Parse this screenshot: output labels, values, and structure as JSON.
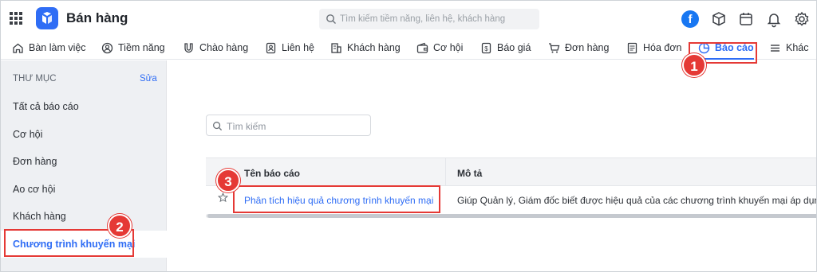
{
  "app": {
    "title": "Bán hàng"
  },
  "top_search": {
    "placeholder": "Tìm kiếm tiềm năng, liên hệ, khách hàng"
  },
  "top_icons": {
    "facebook_letter": "f"
  },
  "nav": {
    "items": [
      {
        "label": "Bàn làm việc",
        "icon": "home-icon"
      },
      {
        "label": "Tiềm năng",
        "icon": "user-circle-icon"
      },
      {
        "label": "Chào hàng",
        "icon": "magnet-icon"
      },
      {
        "label": "Liên hệ",
        "icon": "contact-card-icon"
      },
      {
        "label": "Khách hàng",
        "icon": "building-icon"
      },
      {
        "label": "Cơ hội",
        "icon": "wallet-icon"
      },
      {
        "label": "Báo giá",
        "icon": "dollar-doc-icon"
      },
      {
        "label": "Đơn hàng",
        "icon": "cart-icon"
      },
      {
        "label": "Hóa đơn",
        "icon": "invoice-icon"
      },
      {
        "label": "Báo cáo",
        "icon": "pie-chart-icon",
        "active": true
      },
      {
        "label": "Khác",
        "icon": "menu-icon"
      }
    ]
  },
  "sidebar": {
    "heading": "THƯ MỤC",
    "edit_label": "Sửa",
    "items": [
      {
        "label": "Tất cả báo cáo"
      },
      {
        "label": "Cơ hội"
      },
      {
        "label": "Đơn hàng"
      },
      {
        "label": "Ao cơ hội"
      },
      {
        "label": "Khách hàng"
      },
      {
        "label": "Chương trình khuyến mại",
        "active": true
      }
    ]
  },
  "main": {
    "search_placeholder": "Tìm kiếm",
    "table": {
      "columns": [
        "Tên báo cáo",
        "Mô tả"
      ],
      "rows": [
        {
          "name": "Phân tích hiệu quả chương trình khuyến mại",
          "description": "Giúp Quản lý, Giám đốc biết được hiệu quả của các chương trình khuyến mại áp dụng trong"
        }
      ]
    }
  },
  "annotations": {
    "step1": "1",
    "step2": "2",
    "step3": "3"
  },
  "colors": {
    "accent": "#2f6df5",
    "annotation": "#e53935",
    "sidebar_bg": "#eef0f3"
  }
}
